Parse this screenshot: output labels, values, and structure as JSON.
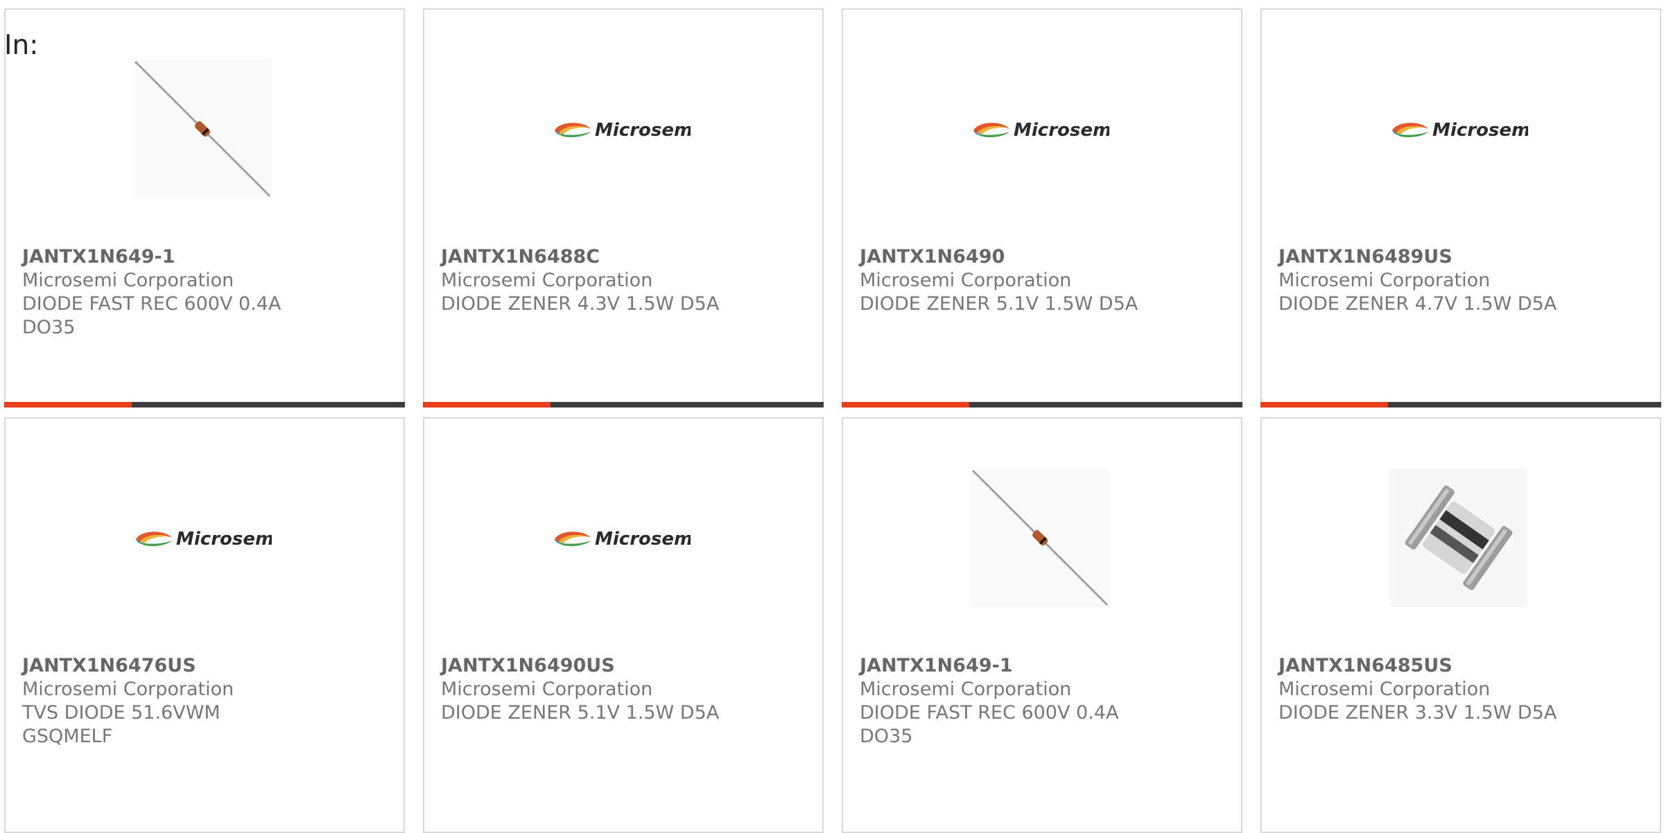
{
  "filter_label": "In:",
  "colors": {
    "accent": "#e8401c",
    "bar_dark": "#3d3d3d",
    "card_border": "#d9d9d9",
    "part_number": "#666666",
    "text": "#777777"
  },
  "products": [
    {
      "part_number": "JANTX1N649-1",
      "manufacturer": "Microsemi Corporation",
      "description_line1": "DIODE FAST REC 600V 0.4A",
      "description_line2": "DO35",
      "image": "axial-diode-image"
    },
    {
      "part_number": "JANTX1N6488C",
      "manufacturer": "Microsemi Corporation",
      "description_line1": "DIODE ZENER 4.3V 1.5W D5A",
      "description_line2": "",
      "image": "microsemi-logo",
      "logo_text": "Microsemi"
    },
    {
      "part_number": "JANTX1N6490",
      "manufacturer": "Microsemi Corporation",
      "description_line1": "DIODE ZENER 5.1V 1.5W D5A",
      "description_line2": "",
      "image": "microsemi-logo",
      "logo_text": "Microsemi"
    },
    {
      "part_number": "JANTX1N6489US",
      "manufacturer": "Microsemi Corporation",
      "description_line1": "DIODE ZENER 4.7V 1.5W D5A",
      "description_line2": "",
      "image": "microsemi-logo",
      "logo_text": "Microsemi"
    },
    {
      "part_number": "JANTX1N6476US",
      "manufacturer": "Microsemi Corporation",
      "description_line1": "TVS DIODE 51.6VWM GSQMELF",
      "description_line2": "",
      "image": "microsemi-logo",
      "logo_text": "Microsemi"
    },
    {
      "part_number": "JANTX1N6490US",
      "manufacturer": "Microsemi Corporation",
      "description_line1": "DIODE ZENER 5.1V 1.5W D5A",
      "description_line2": "",
      "image": "microsemi-logo",
      "logo_text": "Microsemi"
    },
    {
      "part_number": "JANTX1N649-1",
      "manufacturer": "Microsemi Corporation",
      "description_line1": "DIODE FAST REC 600V 0.4A",
      "description_line2": "DO35",
      "image": "axial-diode-image"
    },
    {
      "part_number": "JANTX1N6485US",
      "manufacturer": "Microsemi Corporation",
      "description_line1": "DIODE ZENER 3.3V 1.5W D5A",
      "description_line2": "",
      "image": "melf-diode-image"
    }
  ]
}
